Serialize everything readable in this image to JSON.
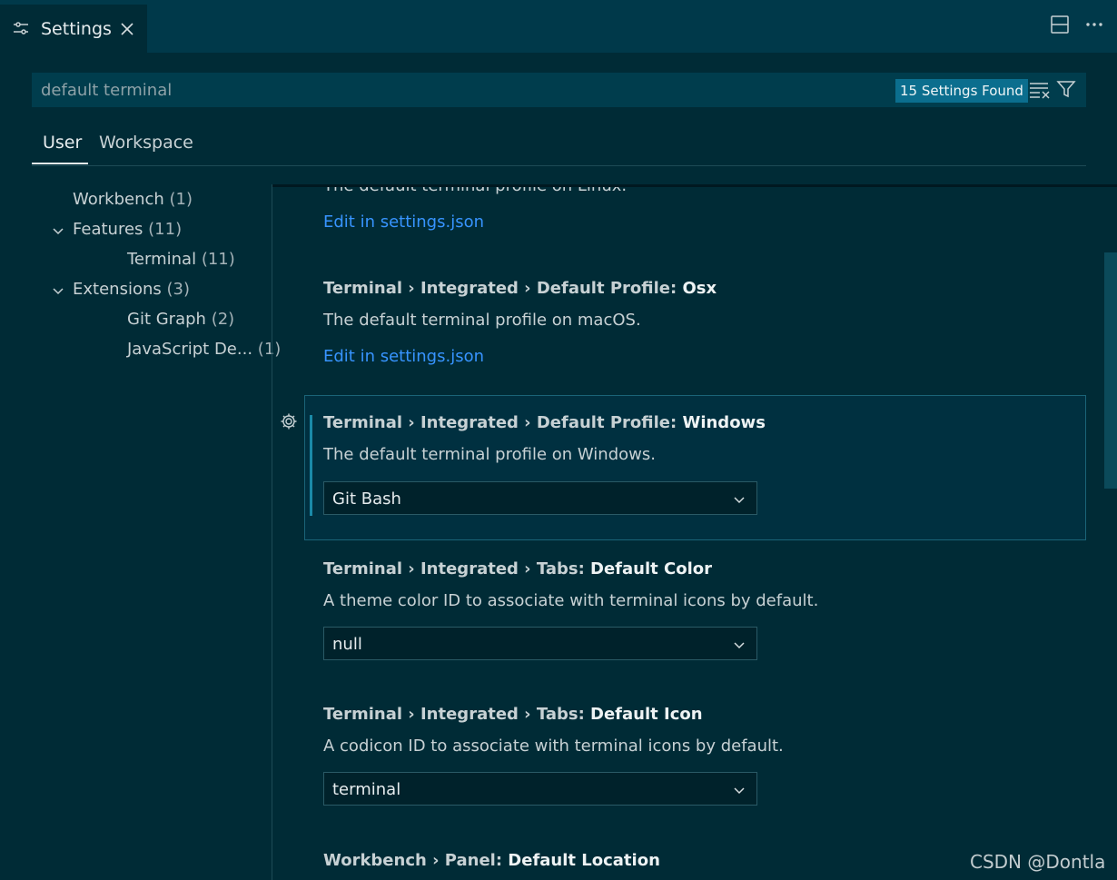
{
  "tab": {
    "title": "Settings"
  },
  "search": {
    "value": "default terminal",
    "count_label": "15 Settings Found"
  },
  "scope": {
    "user": "User",
    "workspace": "Workspace"
  },
  "toc": {
    "workbench": {
      "label": "Workbench",
      "count": "(1)"
    },
    "features": {
      "label": "Features",
      "count": "(11)"
    },
    "terminal": {
      "label": "Terminal",
      "count": "(11)"
    },
    "extensions": {
      "label": "Extensions",
      "count": "(3)"
    },
    "gitgraph": {
      "label": "Git Graph",
      "count": "(2)"
    },
    "javascript": {
      "label": "JavaScript De...",
      "count": "(1)"
    }
  },
  "settings": {
    "linux": {
      "desc": "The default terminal profile on Linux.",
      "link": "Edit in settings.json"
    },
    "osx": {
      "prefix": "Terminal › Integrated › Default Profile: ",
      "key": "Osx",
      "desc": "The default terminal profile on macOS.",
      "link": "Edit in settings.json"
    },
    "windows": {
      "prefix": "Terminal › Integrated › Default Profile: ",
      "key": "Windows",
      "desc": "The default terminal profile on Windows.",
      "value": "Git Bash"
    },
    "tabs_color": {
      "prefix": "Terminal › Integrated › Tabs: ",
      "key": "Default Color",
      "desc": "A theme color ID to associate with terminal icons by default.",
      "value": "null"
    },
    "tabs_icon": {
      "prefix": "Terminal › Integrated › Tabs: ",
      "key": "Default Icon",
      "desc": "A codicon ID to associate with terminal icons by default.",
      "value": "terminal"
    },
    "panel": {
      "prefix": "Workbench › Panel: ",
      "key": "Default Location"
    }
  },
  "watermark": "CSDN @Dontla",
  "colors": {
    "background": "#002b36",
    "accent": "#0b6e8e",
    "link": "#3794ff"
  }
}
